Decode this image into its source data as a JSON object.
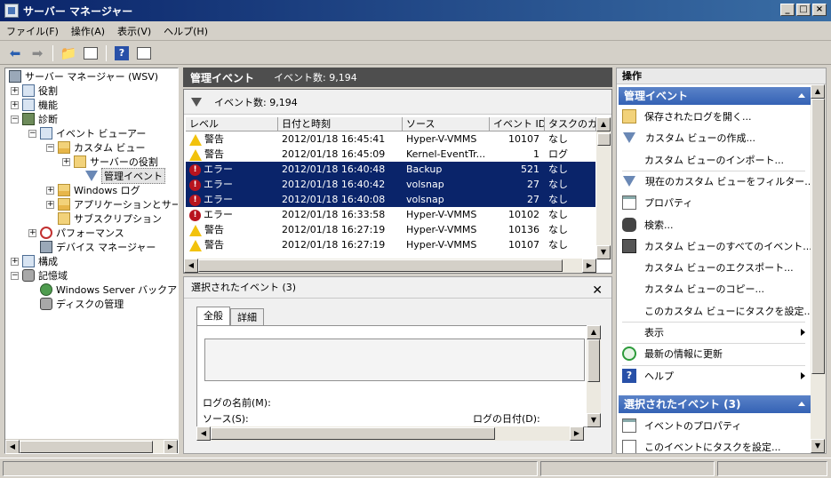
{
  "window": {
    "title": "サーバー マネージャー"
  },
  "menubar": [
    "ファイル(F)",
    "操作(A)",
    "表示(V)",
    "ヘルプ(H)"
  ],
  "tree": {
    "root": "サーバー マネージャー (WSV)",
    "nodes": [
      {
        "label": "役割"
      },
      {
        "label": "機能"
      },
      {
        "label": "診断"
      },
      {
        "label": "イベント ビューアー"
      },
      {
        "label": "カスタム ビュー"
      },
      {
        "label": "サーバーの役割"
      },
      {
        "label": "管理イベント"
      },
      {
        "label": "Windows ログ"
      },
      {
        "label": "アプリケーションとサービス"
      },
      {
        "label": "サブスクリプション"
      },
      {
        "label": "パフォーマンス"
      },
      {
        "label": "デバイス マネージャー"
      },
      {
        "label": "構成"
      },
      {
        "label": "記憶域"
      },
      {
        "label": "Windows Server バックアップ"
      },
      {
        "label": "ディスクの管理"
      }
    ]
  },
  "center": {
    "title": "管理イベント",
    "count_label": "イベント数: 9,194",
    "filter_label": "イベント数: 9,194",
    "columns": [
      "レベル",
      "日付と時刻",
      "ソース",
      "イベント ID",
      "タスクのカテゴリ"
    ],
    "rows": [
      {
        "level": "警告",
        "type": "warning",
        "datetime": "2012/01/18 16:45:41",
        "source": "Hyper-V-VMMS",
        "id": "10107",
        "task": "なし",
        "selected": false
      },
      {
        "level": "警告",
        "type": "warning",
        "datetime": "2012/01/18 16:45:09",
        "source": "Kernel-EventTr...",
        "id": "1",
        "task": "ログ",
        "selected": false
      },
      {
        "level": "エラー",
        "type": "error",
        "datetime": "2012/01/18 16:40:48",
        "source": "Backup",
        "id": "521",
        "task": "なし",
        "selected": true
      },
      {
        "level": "エラー",
        "type": "error",
        "datetime": "2012/01/18 16:40:42",
        "source": "volsnap",
        "id": "27",
        "task": "なし",
        "selected": true
      },
      {
        "level": "エラー",
        "type": "error",
        "datetime": "2012/01/18 16:40:08",
        "source": "volsnap",
        "id": "27",
        "task": "なし",
        "selected": true
      },
      {
        "level": "エラー",
        "type": "error",
        "datetime": "2012/01/18 16:33:58",
        "source": "Hyper-V-VMMS",
        "id": "10102",
        "task": "なし",
        "selected": false
      },
      {
        "level": "警告",
        "type": "warning",
        "datetime": "2012/01/18 16:27:19",
        "source": "Hyper-V-VMMS",
        "id": "10136",
        "task": "なし",
        "selected": false
      },
      {
        "level": "警告",
        "type": "warning",
        "datetime": "2012/01/18 16:27:19",
        "source": "Hyper-V-VMMS",
        "id": "10107",
        "task": "なし",
        "selected": false
      }
    ]
  },
  "detail": {
    "title": "選択されたイベント (3)",
    "tabs": [
      "全般",
      "詳細"
    ],
    "log_name_label": "ログの名前(M):",
    "source_label": "ソース(S):",
    "log_date_label": "ログの日付(D):"
  },
  "actions": {
    "header": "操作",
    "section1": "管理イベント",
    "items1": [
      {
        "label": "保存されたログを開く...",
        "icon": "open-log-icon"
      },
      {
        "label": "カスタム ビューの作成...",
        "icon": "filter-icon"
      },
      {
        "label": "カスタム ビューのインポート...",
        "icon": ""
      },
      {
        "label": "現在のカスタム ビューをフィルター...",
        "icon": "filter-icon"
      },
      {
        "label": "プロパティ",
        "icon": "properties-icon"
      },
      {
        "label": "検索...",
        "icon": "binoculars-icon"
      },
      {
        "label": "カスタム ビューのすべてのイベント...",
        "icon": "save-icon"
      },
      {
        "label": "カスタム ビューのエクスポート...",
        "icon": ""
      },
      {
        "label": "カスタム ビューのコピー...",
        "icon": ""
      },
      {
        "label": "このカスタム ビューにタスクを設定...",
        "icon": ""
      },
      {
        "label": "表示",
        "icon": ""
      },
      {
        "label": "最新の情報に更新",
        "icon": "refresh-icon"
      },
      {
        "label": "ヘルプ",
        "icon": "help-icon"
      }
    ],
    "section2": "選択されたイベント (3)",
    "items2": [
      {
        "label": "イベントのプロパティ",
        "icon": "properties-icon"
      },
      {
        "label": "このイベントにタスクを設定...",
        "icon": "task-icon"
      }
    ]
  }
}
